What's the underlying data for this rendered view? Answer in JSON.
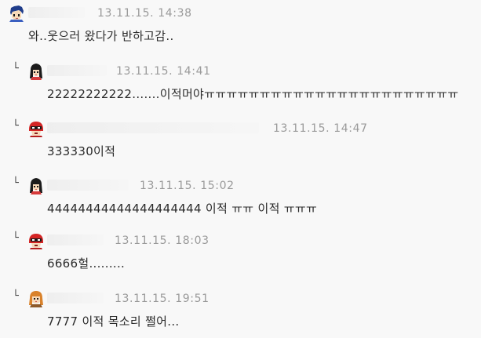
{
  "comments": [
    {
      "reply": false,
      "avatar": "boy-blue-hair-icon",
      "timestamp": "13.11.15. 14:38",
      "text": "와..웃으러 왔다가 반하고감.."
    },
    {
      "reply": true,
      "reply_mark": "└",
      "avatar": "girl-black-hair-icon",
      "timestamp": "13.11.15. 14:41",
      "text": "22222222222.......이적머야ㅠㅠㅠㅠㅠㅠㅠㅠㅠㅠㅠㅠㅠㅠㅠㅠㅠㅠㅠㅠㅠㅠㅠ"
    },
    {
      "reply": true,
      "reply_mark": "└",
      "avatar": "red-helmet-icon",
      "timestamp": "13.11.15. 14:47",
      "text": "333330이적"
    },
    {
      "reply": true,
      "reply_mark": "└",
      "avatar": "girl-black-hair-icon",
      "timestamp": "13.11.15. 15:02",
      "text": "44444444444444444444 이적 ㅠㅠ 이적 ㅠㅠㅠ"
    },
    {
      "reply": true,
      "reply_mark": "└",
      "avatar": "red-helmet-icon",
      "timestamp": "13.11.15. 18:03",
      "text": "6666헐........."
    },
    {
      "reply": true,
      "reply_mark": "└",
      "avatar": "girl-orange-hair-icon",
      "timestamp": "13.11.15. 19:51",
      "text": "7777 이적 목소리 쩔어..."
    }
  ]
}
